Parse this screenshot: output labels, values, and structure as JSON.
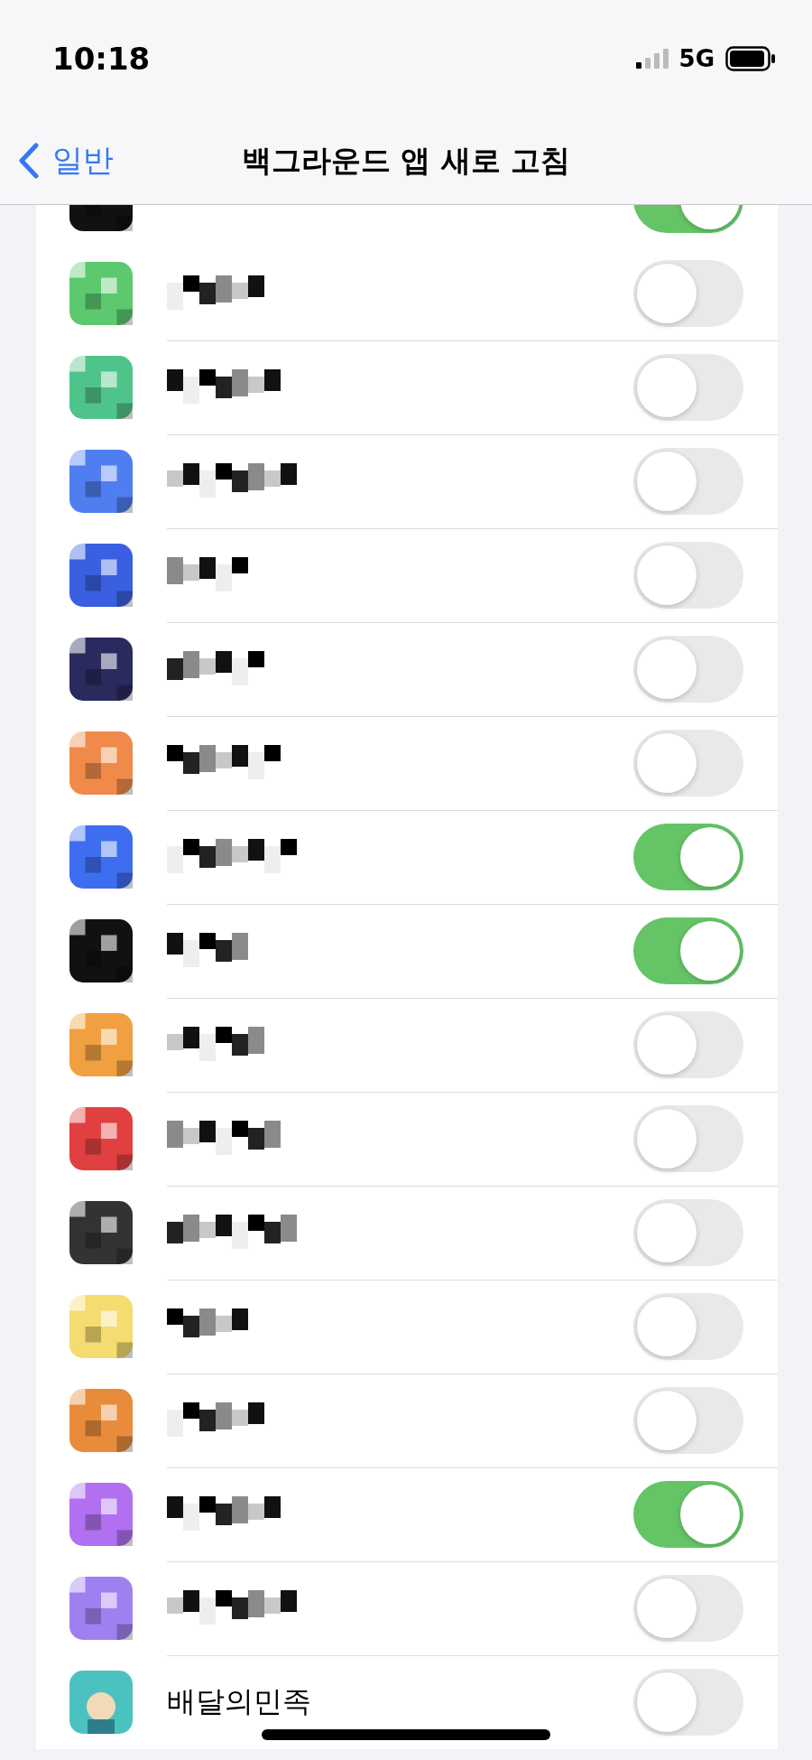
{
  "status_bar": {
    "time": "10:18",
    "network": "5G"
  },
  "nav": {
    "back": "일반",
    "title": "백그라운드 앱 새로 고침"
  },
  "apps": [
    {
      "on": true,
      "color": "#111111"
    },
    {
      "on": false,
      "color": "#5cc96e"
    },
    {
      "on": false,
      "color": "#4fc48a"
    },
    {
      "on": false,
      "color": "#4f7ef0"
    },
    {
      "on": false,
      "color": "#3a5fe0"
    },
    {
      "on": false,
      "color": "#2a2a5e"
    },
    {
      "on": false,
      "color": "#f08a4a"
    },
    {
      "on": true,
      "color": "#3d6ef0"
    },
    {
      "on": true,
      "color": "#111111"
    },
    {
      "on": false,
      "color": "#f0a040"
    },
    {
      "on": false,
      "color": "#e04040"
    },
    {
      "on": false,
      "color": "#333333"
    },
    {
      "on": false,
      "color": "#f5dc70"
    },
    {
      "on": false,
      "color": "#e88c3c"
    },
    {
      "on": true,
      "color": "#b070f0"
    },
    {
      "on": false,
      "color": "#a080f0"
    },
    {
      "on": false,
      "color": "#4cc2c0",
      "name": "배달의민족"
    }
  ]
}
